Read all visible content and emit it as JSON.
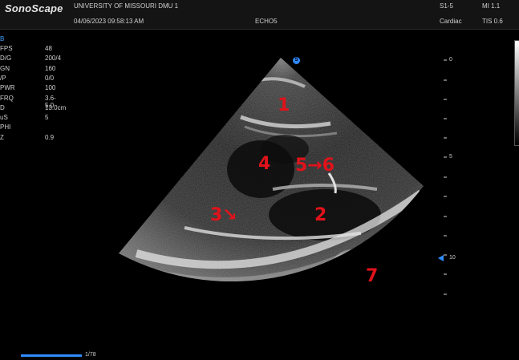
{
  "header": {
    "logo": "SonoScape",
    "institution": "UNIVERSITY OF MISSOURI DMU 1",
    "datetime": "04/06/2023 09:58:13 AM",
    "preset": "ECHO5",
    "probe": "S1-5",
    "mi": "MI 1.1",
    "exam": "Cardiac",
    "tis": "TIS 0.6"
  },
  "mode": "B",
  "params": [
    {
      "key": "FPS",
      "value": "48"
    },
    {
      "key": "D/G",
      "value": "200/4"
    },
    {
      "key": "GN",
      "value": "160"
    },
    {
      "key": "/P",
      "value": "0/0"
    },
    {
      "key": "PWR",
      "value": "100"
    },
    {
      "key": "FRQ",
      "value": "3.6-5.0"
    },
    {
      "key": "D",
      "value": "13.0cm"
    },
    {
      "key": "uS",
      "value": "5"
    },
    {
      "key": "PHI",
      "value": ""
    },
    {
      "key": "Z",
      "value": "0.9"
    }
  ],
  "depth_scale": [
    "0",
    "5",
    "10"
  ],
  "probe_orientation_icon": "S",
  "annotations": [
    "1",
    "4",
    "5→6",
    "3↘",
    "2",
    "7"
  ],
  "cine": {
    "frame_counter": "1/78",
    "progress": 1.0
  },
  "colors": {
    "accent": "#2f8cff",
    "annotation": "#e0121a"
  }
}
